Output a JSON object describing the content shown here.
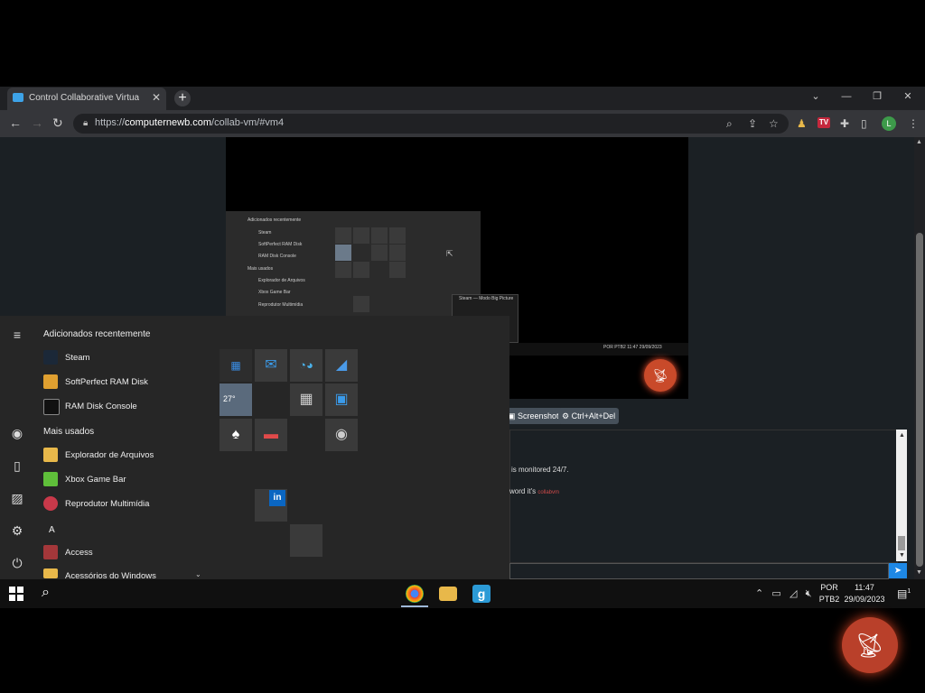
{
  "browser": {
    "tab_title": "Control Collaborative Virtual Ma",
    "new_tab": "+",
    "url_prefix": "https://",
    "url_host": "computernewb.com",
    "url_path": "/collab-vm/#vm4",
    "profile_letter": "L",
    "ext_label": "TV",
    "window_buttons": [
      "⌄",
      "—",
      "❐",
      "✕"
    ]
  },
  "vm_inner": {
    "start_menu": {
      "recent_header": "Adicionados recentemente",
      "recent": [
        "Steam",
        "SoftPerfect RAM Disk",
        "RAM Disk Console"
      ],
      "most_used_header": "Mais usados",
      "most_used": [
        "Explorador de Arquivos",
        "Xbox Game Bar",
        "Reprodutor Multimídia"
      ]
    },
    "steam_window_title": "Steam — Modo Big Picture",
    "tray_lang": "POR PTB2",
    "tray_time": "11:47",
    "tray_date": "29/09/2023"
  },
  "vm_controls": {
    "screenshot_label": "Screenshot",
    "ctrl_alt_del_label": "Ctrl+Alt+Del"
  },
  "chat": {
    "line1": "is monitored 24/7.",
    "line2_prefix": "word it's",
    "line2_link": "collabvm"
  },
  "start_menu": {
    "recent_header": "Adicionados recentemente",
    "recent_items": [
      {
        "label": "Steam",
        "color": "#1b2838"
      },
      {
        "label": "SoftPerfect RAM Disk",
        "color": "#e0a030"
      },
      {
        "label": "RAM Disk Console",
        "color": "#111111"
      }
    ],
    "most_used_header": "Mais usados",
    "most_used_items": [
      {
        "label": "Explorador de Arquivos",
        "color": "#e8b84a"
      },
      {
        "label": "Xbox Game Bar",
        "color": "#5fbf3a"
      },
      {
        "label": "Reprodutor Multimídia",
        "color": "#c9394a"
      }
    ],
    "letter_header": "A",
    "a_items": [
      {
        "label": "Access",
        "color": "#a4373a"
      },
      {
        "label": "Acessórios do Windows",
        "color": "#e8b84a"
      }
    ],
    "weather_tile": "27°"
  },
  "taskbar": {
    "tray_lang_1": "POR",
    "tray_lang_2": "PTB2",
    "time": "11:47",
    "date": "29/09/2023",
    "notification_count": "1"
  },
  "colors": {
    "accent": "#1e88e5",
    "cast_button": "#b9402a"
  }
}
